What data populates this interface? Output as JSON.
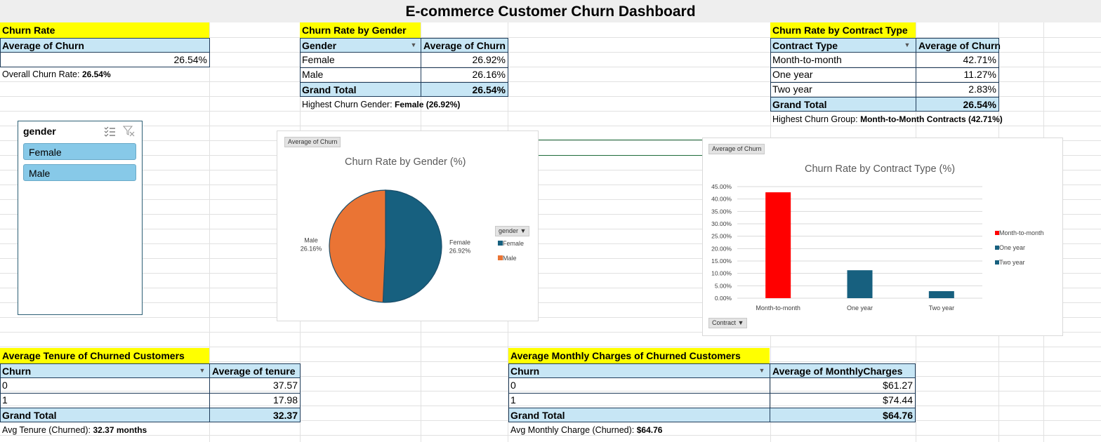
{
  "title": "E-commerce Customer Churn Dashboard",
  "churn_rate": {
    "label": "Churn Rate",
    "header": "Average of Churn",
    "value": "26.54%",
    "note_label": "Overall Churn Rate:",
    "note_value": "26.54%"
  },
  "gender_table": {
    "label": "Churn Rate by Gender",
    "col1": "Gender",
    "col2": "Average of Churn",
    "rows": [
      {
        "name": "Female",
        "value": "26.92%"
      },
      {
        "name": "Male",
        "value": "26.16%"
      }
    ],
    "total_label": "Grand Total",
    "total_value": "26.54%",
    "note_label": "Highest Churn Gender:",
    "note_value": "Female (26.92%)"
  },
  "contract_table": {
    "label": "Churn Rate by Contract Type",
    "col1": "Contract Type",
    "col2": "Average of Churn",
    "rows": [
      {
        "name": "Month-to-month",
        "value": "42.71%"
      },
      {
        "name": "One year",
        "value": "11.27%"
      },
      {
        "name": "Two year",
        "value": "2.83%"
      }
    ],
    "total_label": "Grand Total",
    "total_value": "26.54%",
    "note_label": "Highest Churn Group:",
    "note_value": "Month-to-Month Contracts (42.71%)"
  },
  "slicer": {
    "title": "gender",
    "items": [
      "Female",
      "Male"
    ]
  },
  "tenure_table": {
    "label": "Average Tenure of Churned Customers",
    "col1": "Churn",
    "col2": "Average of tenure",
    "rows": [
      {
        "name": "0",
        "value": "37.57"
      },
      {
        "name": "1",
        "value": "17.98"
      }
    ],
    "total_label": "Grand Total",
    "total_value": "32.37",
    "note_label": "Avg Tenure (Churned):",
    "note_value": "32.37 months"
  },
  "charges_table": {
    "label": "Average Monthly Charges of Churned Customers",
    "col1": "Churn",
    "col2": "Average of MonthlyCharges",
    "rows": [
      {
        "name": "0",
        "value": "$61.27"
      },
      {
        "name": "1",
        "value": "$74.44"
      }
    ],
    "total_label": "Grand Total",
    "total_value": "$64.76",
    "note_label": "Avg Monthly Charge (Churned):",
    "note_value": "$64.76"
  },
  "chart_data": [
    {
      "type": "pie",
      "title": "Churn Rate by Gender (%)",
      "field_button": "Average of Churn",
      "legend_button": "gender",
      "legend_position": "right",
      "categories": [
        "Female",
        "Male"
      ],
      "values": [
        26.92,
        26.16
      ],
      "labels": [
        "26.92%",
        "26.16%"
      ],
      "colors": [
        "#17607f",
        "#ea7434"
      ]
    },
    {
      "type": "bar",
      "title": "Churn Rate by Contract Type (%)",
      "field_button": "Average of Churn",
      "axis_button": "Contract",
      "legend_position": "right",
      "categories": [
        "Month-to-month",
        "One year",
        "Two year"
      ],
      "values": [
        42.71,
        11.27,
        2.83
      ],
      "colors": [
        "#ff0000",
        "#17607f",
        "#17607f"
      ],
      "y_ticks": [
        "0.00%",
        "5.00%",
        "10.00%",
        "15.00%",
        "20.00%",
        "25.00%",
        "30.00%",
        "35.00%",
        "40.00%",
        "45.00%"
      ],
      "ylim": [
        0,
        45
      ],
      "grid": true
    }
  ]
}
